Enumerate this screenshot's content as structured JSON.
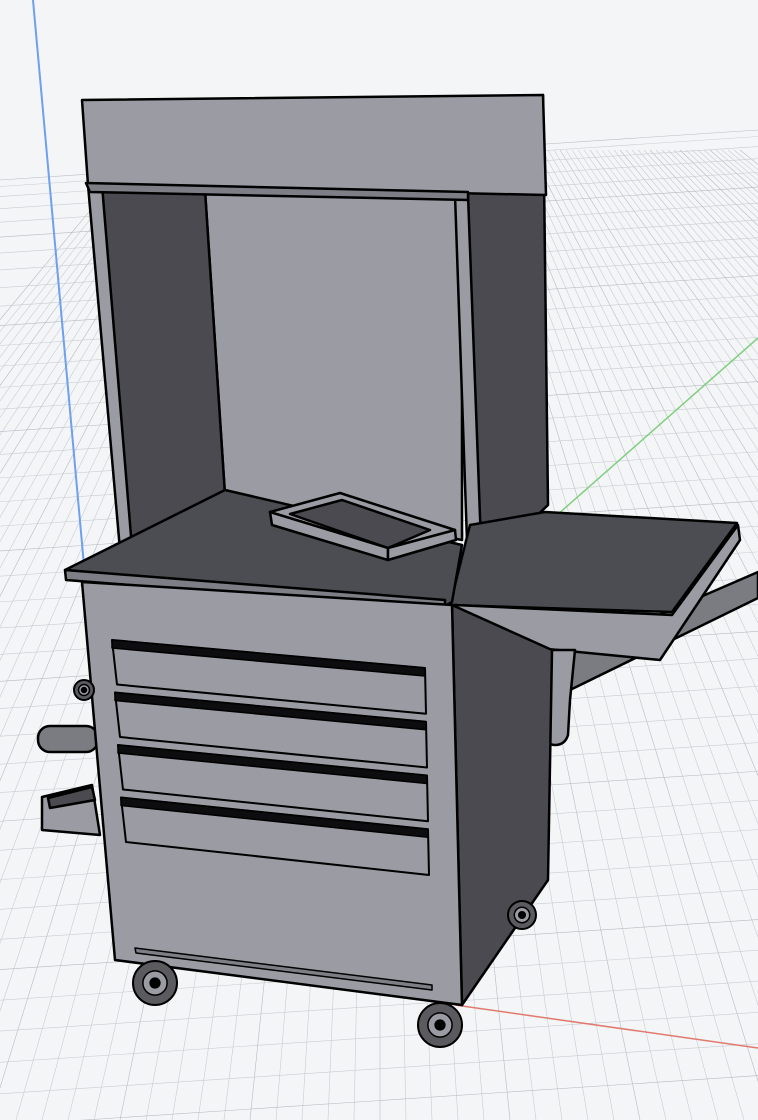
{
  "viewport": {
    "background": "#f4f5f7",
    "grid_color": "#c8ccd2",
    "grid_major_color": "#b6bbc2"
  },
  "axes": {
    "z_axis_color": "#6ea0ef",
    "y_axis_color": "#7fcf7f",
    "x_axis_color": "#e07a6e"
  },
  "model": {
    "icon": "tool-cart-workstation-icon",
    "colors": {
      "light_face": "#9a9ba3",
      "mid_face": "#7d7e86",
      "dark_face": "#4a4a50",
      "top_face": "#4c4d52",
      "outline": "#000000",
      "handle": "#0d0d10",
      "wheel": "#5a5a5f",
      "bar": "#7b7c82"
    },
    "drawer_count": 4,
    "caster_count": 4
  }
}
